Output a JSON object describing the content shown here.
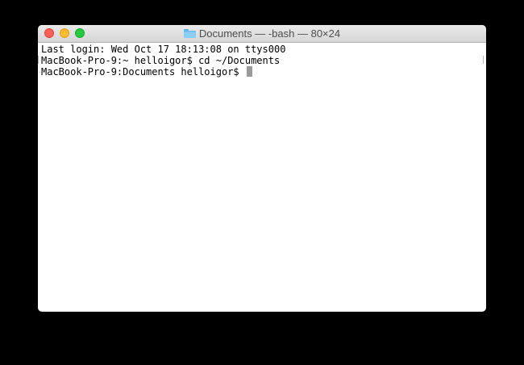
{
  "window": {
    "title": "Documents — -bash — 80×24",
    "folder_icon": "folder-icon",
    "traffic_lights": {
      "close_color": "#fe5f57",
      "minimize_color": "#febc2e",
      "maximize_color": "#28c840"
    }
  },
  "terminal": {
    "lines": [
      "Last login: Wed Oct 17 18:13:08 on ttys000",
      "MacBook-Pro-9:~ helloigor$ cd ~/Documents",
      "MacBook-Pro-9:Documents helloigor$ "
    ],
    "cursor": "block-cursor"
  }
}
